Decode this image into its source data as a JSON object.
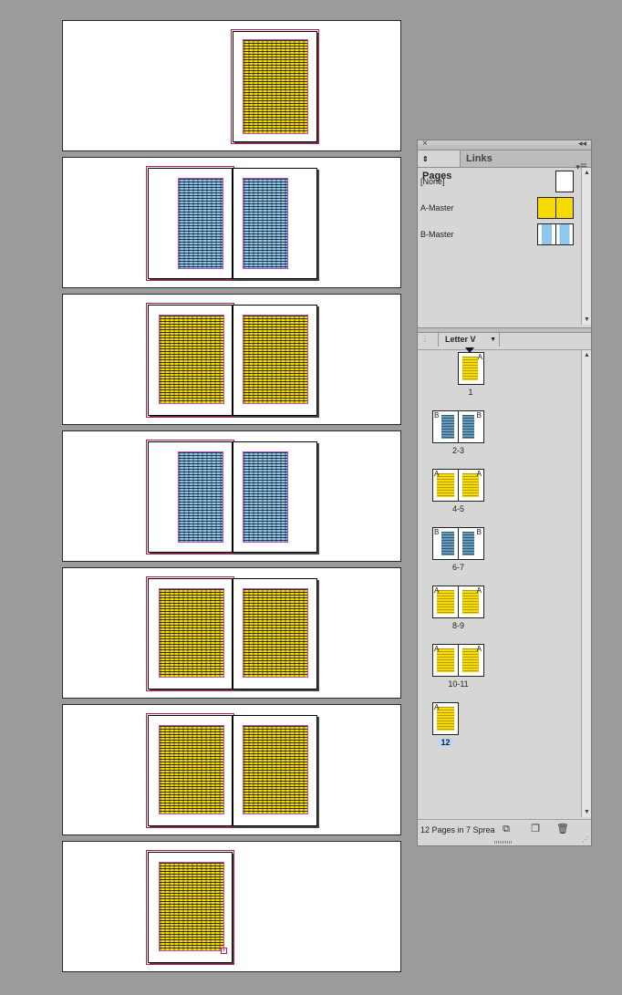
{
  "pages_panel": {
    "tabs": [
      {
        "label": "Pages",
        "icon": "updown-arrows-icon"
      },
      {
        "label": "Links"
      }
    ],
    "masters": [
      {
        "label": "[None]"
      },
      {
        "label": "A-Master",
        "color": "#f6dc00"
      },
      {
        "label": "B-Master",
        "color": "#8ec8ee"
      }
    ],
    "page_size_label": "Letter V",
    "spreads": [
      {
        "label": "1",
        "master": "A"
      },
      {
        "label": "2-3",
        "master": "B"
      },
      {
        "label": "4-5",
        "master": "A"
      },
      {
        "label": "6-7",
        "master": "B"
      },
      {
        "label": "8-9",
        "master": "A"
      },
      {
        "label": "10-11",
        "master": "A"
      },
      {
        "label": "12",
        "master": "A",
        "selected": true
      }
    ],
    "status_text": "12 Pages in 7 Sprea"
  },
  "colors": {
    "yellow_text_frame": "#f6dc00",
    "blue_text_frame": "#8ec8ee",
    "bleed_guide": "#c2185b",
    "margin_guide": "#b24fd6",
    "pasteboard": "#9b9b9b"
  }
}
